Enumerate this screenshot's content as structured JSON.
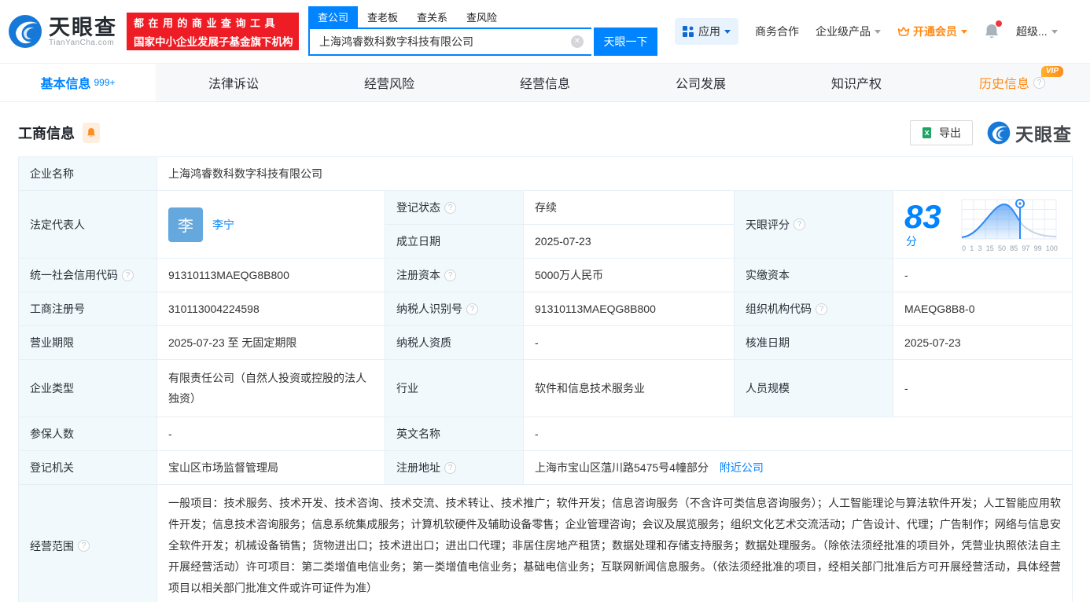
{
  "header": {
    "logo": {
      "title": "天眼查",
      "subtitle": "TianYanCha.com"
    },
    "slogan": {
      "line1": "都在用的商业查询工具",
      "line2": "国家中小企业发展子基金旗下机构"
    },
    "search": {
      "tabs": [
        {
          "label": "查公司",
          "active": true
        },
        {
          "label": "查老板",
          "active": false
        },
        {
          "label": "查关系",
          "active": false
        },
        {
          "label": "查风险",
          "active": false
        }
      ],
      "value": "上海鸿睿数科数字科技有限公司",
      "button": "天眼一下"
    },
    "nav": {
      "apps": "应用",
      "cooperation": "商务合作",
      "enterprise": "企业级产品",
      "vip": "开通会员",
      "super": "超级..."
    }
  },
  "tabbar": {
    "vip_badge": "VIP",
    "tabs": [
      {
        "label": "基本信息",
        "badge": "999+",
        "active": true
      },
      {
        "label": "法律诉讼"
      },
      {
        "label": "经营风险"
      },
      {
        "label": "经营信息"
      },
      {
        "label": "公司发展"
      },
      {
        "label": "知识产权"
      },
      {
        "label": "历史信息",
        "vip": true
      }
    ]
  },
  "section": {
    "title": "工商信息",
    "export_label": "导出",
    "brand": "天眼查"
  },
  "table": {
    "company_name": {
      "label": "企业名称",
      "value": "上海鸿睿数科数字科技有限公司"
    },
    "legal_rep": {
      "label": "法定代表人",
      "avatar_char": "李",
      "name": "李宁"
    },
    "reg_status": {
      "label": "登记状态",
      "value": "存续"
    },
    "establish_date": {
      "label": "成立日期",
      "value": "2025-07-23"
    },
    "score": {
      "label": "天眼评分",
      "value": "83",
      "unit": "分"
    },
    "rows": [
      {
        "cells": [
          {
            "label": "统一社会信用代码",
            "value": "91310113MAEQG8B800"
          },
          {
            "label": "注册资本",
            "value": "5000万人民币"
          },
          {
            "label": "实缴资本",
            "value": "-"
          }
        ]
      },
      {
        "cells": [
          {
            "label": "工商注册号",
            "value": "310113004224598"
          },
          {
            "label": "纳税人识别号",
            "value": "91310113MAEQG8B800"
          },
          {
            "label": "组织机构代码",
            "value": "MAEQG8B8-0"
          }
        ]
      },
      {
        "cells": [
          {
            "label": "营业期限",
            "value": "2025-07-23 至 无固定期限"
          },
          {
            "label": "纳税人资质",
            "value": "-"
          },
          {
            "label": "核准日期",
            "value": "2025-07-23"
          }
        ]
      },
      {
        "cells": [
          {
            "label": "企业类型",
            "value": "有限责任公司（自然人投资或控股的法人独资）"
          },
          {
            "label": "行业",
            "value": "软件和信息技术服务业"
          },
          {
            "label": "人员规模",
            "value": "-"
          }
        ]
      }
    ],
    "insured": {
      "label": "参保人数",
      "value": "-"
    },
    "english_name": {
      "label": "英文名称",
      "value": "-"
    },
    "reg_authority": {
      "label": "登记机关",
      "value": "宝山区市场监督管理局"
    },
    "reg_address": {
      "label": "注册地址",
      "value": "上海市宝山区蕰川路5475号4幢部分",
      "link": "附近公司"
    },
    "business_scope": {
      "label": "经营范围",
      "value": "一般项目：技术服务、技术开发、技术咨询、技术交流、技术转让、技术推广；软件开发；信息咨询服务（不含许可类信息咨询服务）；人工智能理论与算法软件开发；人工智能应用软件开发；信息技术咨询服务；信息系统集成服务；计算机软硬件及辅助设备零售；企业管理咨询；会议及展览服务；组织文化艺术交流活动；广告设计、代理；广告制作；网络与信息安全软件开发；机械设备销售；货物进出口；技术进出口；进出口代理；非居住房地产租赁；数据处理和存储支持服务；数据处理服务。（除依法须经批准的项目外，凭营业执照依法自主开展经营活动）许可项目：第二类增值电信业务；第一类增值电信业务；基础电信业务；互联网新闻信息服务。（依法须经批准的项目，经相关部门批准后方可开展经营活动，具体经营项目以相关部门批准文件或许可证件为准）"
    }
  },
  "chart_data": {
    "type": "area",
    "title": "天眼评分",
    "score": 83,
    "unit": "分",
    "x_ticks": [
      0,
      1,
      3,
      15,
      50,
      85,
      97,
      99,
      100
    ],
    "marker_tick": 85,
    "curve": "score distribution bell curve, blue filled left of marker, gray right of marker",
    "grid": true
  },
  "colors": {
    "accent_blue": "#0084ff",
    "vip_orange": "#ff8b19",
    "status_green": "#00a854",
    "slogan_red": "#ee1c25",
    "label_cell_bg": "#f2f9fd"
  }
}
